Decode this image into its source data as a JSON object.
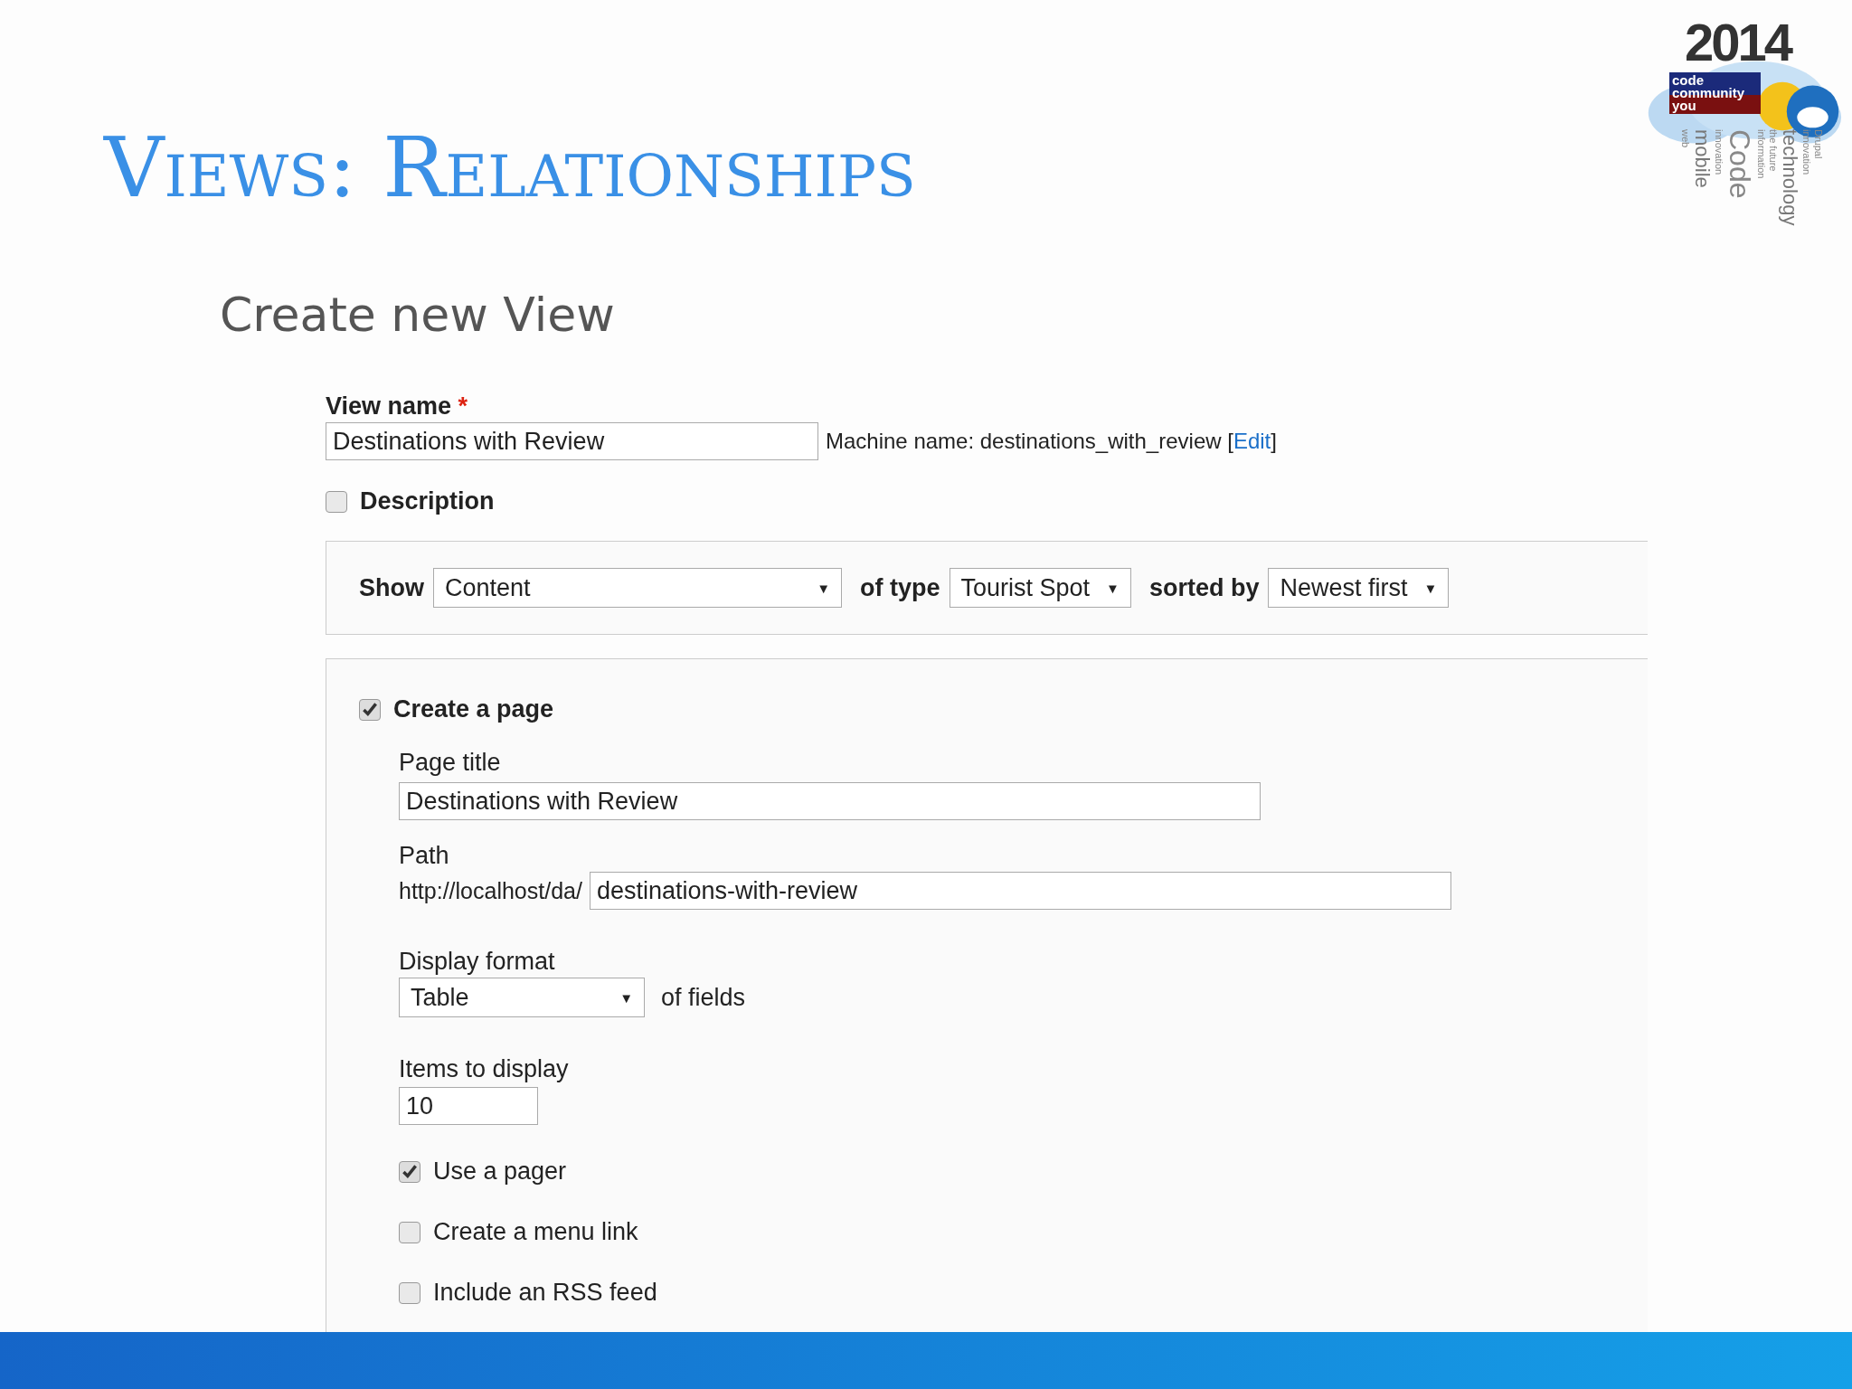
{
  "slide": {
    "title": "Views: Relationships",
    "subtitle": "Create new View"
  },
  "logo": {
    "year": "2014",
    "tagline": [
      "code",
      "community",
      "you"
    ],
    "words": [
      "web",
      "mobile",
      "innovation",
      "Code",
      "information",
      "the future",
      "technology",
      "innovation",
      "Drupal"
    ]
  },
  "view_name": {
    "label": "View name",
    "required_mark": "*",
    "value": "Destinations with Review",
    "machine_name": "Machine name: destinations_with_review",
    "edit_link": "Edit",
    "bracket_open": "[",
    "bracket_close": "]"
  },
  "description": {
    "label": "Description",
    "checked": false
  },
  "show": {
    "label": "Show",
    "value": "Content",
    "type_label": "of type",
    "type_value": "Tourist Spot",
    "sort_label": "sorted by",
    "sort_value": "Newest first",
    "arrow": "▼"
  },
  "page": {
    "label": "Create a page",
    "checked": true,
    "page_title": {
      "label": "Page title",
      "value": "Destinations with Review"
    },
    "path": {
      "label": "Path",
      "prefix": "http://localhost/da/",
      "value": "destinations-with-review"
    },
    "display_format": {
      "label": "Display format",
      "value": "Table",
      "suffix": "of fields"
    },
    "items": {
      "label": "Items to display",
      "value": "10"
    },
    "options": [
      {
        "label": "Use a pager",
        "checked": true
      },
      {
        "label": "Create a menu link",
        "checked": false
      },
      {
        "label": "Include an RSS feed",
        "checked": false
      }
    ]
  }
}
